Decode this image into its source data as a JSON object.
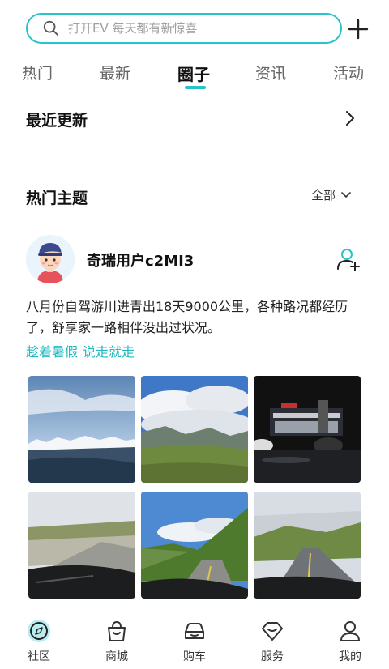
{
  "search": {
    "placeholder": "打开EV 每天都有新惊喜"
  },
  "tabs": [
    {
      "label": "热门"
    },
    {
      "label": "最新"
    },
    {
      "label": "圈子"
    },
    {
      "label": "资讯"
    },
    {
      "label": "活动"
    }
  ],
  "active_tab": "圈子",
  "recent": {
    "title": "最近更新"
  },
  "hot_topics": {
    "title": "热门主题",
    "filter_label": "全部"
  },
  "post": {
    "username": "奇瑞用户c2MI3",
    "text": "八月份自驾游川进青出18天9000公里，各种路况都经历了，舒享家一路相伴没出过状况。",
    "tags": [
      "趁着暑假",
      "说走就走"
    ],
    "photos": [
      "mountain-panorama-photo",
      "cloudy-valley-photo",
      "night-dealership-photo",
      "windshield-road-photo",
      "mountain-road-photo",
      "open-road-photo"
    ]
  },
  "bottom_nav": [
    {
      "label": "社区",
      "icon": "community-icon",
      "active": true
    },
    {
      "label": "商城",
      "icon": "shop-bag-icon",
      "active": false
    },
    {
      "label": "购车",
      "icon": "car-icon",
      "active": false
    },
    {
      "label": "服务",
      "icon": "service-icon",
      "active": false
    },
    {
      "label": "我的",
      "icon": "profile-icon",
      "active": false
    }
  ],
  "colors": {
    "accent": "#27c3c8",
    "tag": "#21b8c2",
    "text": "#1a1a1a"
  }
}
